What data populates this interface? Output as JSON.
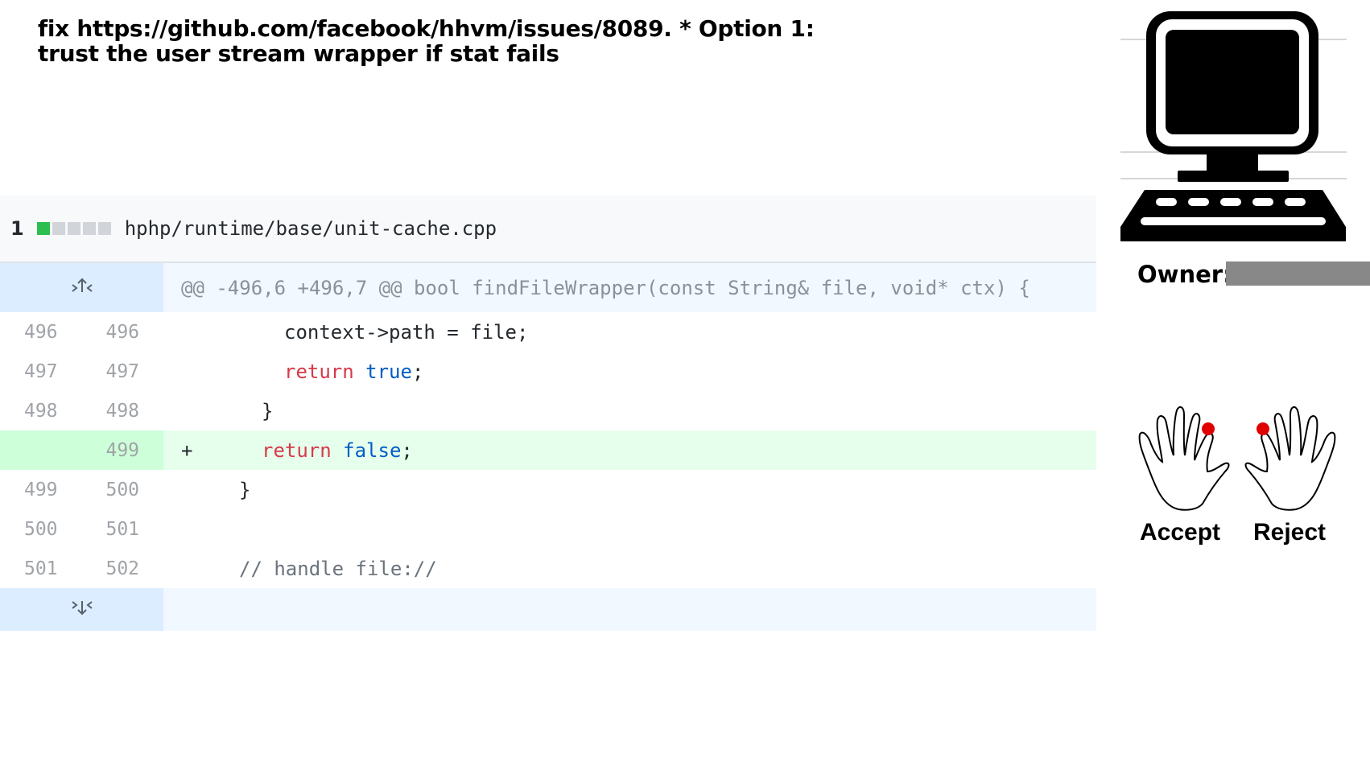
{
  "commit": {
    "title": "fix https://github.com/facebook/hhvm/issues/8089. * Option 1: trust the user stream wrapper if stat fails"
  },
  "diff": {
    "file": {
      "changes_count": "1",
      "stat_blocks": [
        "added",
        "neutral",
        "neutral",
        "neutral",
        "neutral"
      ],
      "path": "hphp/runtime/base/unit-cache.cpp"
    },
    "hunk_header": "@@ -496,6 +496,7 @@ bool findFileWrapper(const String& file, void* ctx) {",
    "lines": [
      {
        "old": "496",
        "new": "496",
        "marker": "",
        "indent": "   ",
        "tokens": [
          {
            "t": "context->path = file;",
            "c": ""
          }
        ],
        "type": "context"
      },
      {
        "old": "497",
        "new": "497",
        "marker": "",
        "indent": "   ",
        "tokens": [
          {
            "t": "return",
            "c": "kw"
          },
          {
            "t": " ",
            "c": ""
          },
          {
            "t": "true",
            "c": "lit"
          },
          {
            "t": ";",
            "c": ""
          }
        ],
        "type": "context"
      },
      {
        "old": "498",
        "new": "498",
        "marker": "",
        "indent": "  ",
        "tokens": [
          {
            "t": "}",
            "c": ""
          }
        ],
        "type": "context"
      },
      {
        "old": "",
        "new": "499",
        "marker": "+",
        "indent": "  ",
        "tokens": [
          {
            "t": "return",
            "c": "kw"
          },
          {
            "t": " ",
            "c": ""
          },
          {
            "t": "false",
            "c": "lit"
          },
          {
            "t": ";",
            "c": ""
          }
        ],
        "type": "added"
      },
      {
        "old": "499",
        "new": "500",
        "marker": "",
        "indent": " ",
        "tokens": [
          {
            "t": "}",
            "c": ""
          }
        ],
        "type": "context"
      },
      {
        "old": "500",
        "new": "501",
        "marker": "",
        "indent": "",
        "tokens": [],
        "type": "context"
      },
      {
        "old": "501",
        "new": "502",
        "marker": "",
        "indent": " ",
        "tokens": [
          {
            "t": "// handle file://",
            "c": "cm"
          }
        ],
        "type": "context"
      }
    ]
  },
  "review": {
    "owner_label": "Owner:",
    "accept_label": "Accept",
    "reject_label": "Reject",
    "icons": [
      "computer-icon",
      "left-hand-icon",
      "right-hand-icon",
      "expand-up-icon",
      "expand-down-icon"
    ],
    "finger_marker_color": "#e00000"
  }
}
